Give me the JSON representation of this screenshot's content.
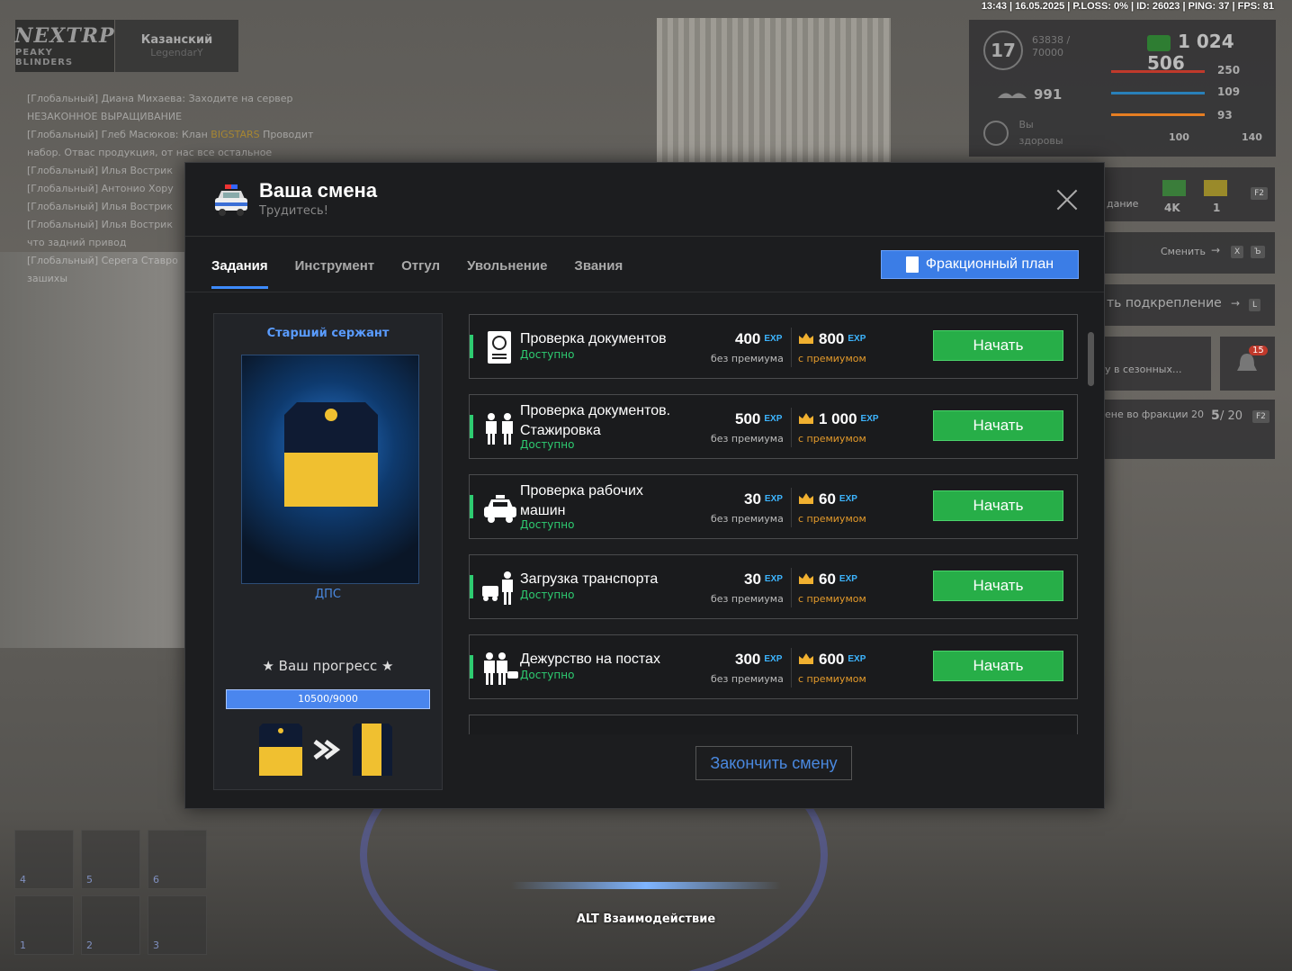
{
  "statusbar": {
    "text": "13:43 | 16.05.2025 | P.LOSS: 0% | ID: 26023 | PING: 37 | FPS: 81"
  },
  "logo": {
    "main": "NEXTRP",
    "sub": "PEAKY BLINDERS"
  },
  "server": {
    "name": "Казанский",
    "sub": "LegendarY"
  },
  "chat": {
    "lines": [
      "[Глобальный] Диана Михаева: Заходите на сервер",
      "НЕЗАКОННОЕ ВЫРАЩИВАНИЕ",
      "[Глобальный] Глеб Масюков: Клан",
      "набор. Отвас продукция, от нас все остальное",
      "[Глобальный] Илья Вострик",
      "[Глобальный] Антонио Хору",
      "[Глобальный] Илья Вострик",
      "[Глобальный] Илья Вострик",
      "что задний привод",
      "[Глобальный] Серега Ставро",
      "зашихы"
    ],
    "clan_tag": "BIGSTARS",
    "clan_suffix": "Проводит"
  },
  "hud": {
    "level": "17",
    "xp": "63838 /",
    "xp_max": "70000",
    "money": "1 024 506",
    "run": "991",
    "health_text": "Вы",
    "health_text2": "здоровы",
    "stats": [
      "250",
      "109",
      "93"
    ],
    "bottom_left": "100",
    "bottom_right": "140",
    "bar_colors": [
      "#c0392b",
      "#2980b9",
      "#e67e22"
    ]
  },
  "hud_cards": {
    "bonus_label": "дание",
    "bonus_a": "4K",
    "bonus_b": "1",
    "f2": "F2",
    "change_label": "Сменить",
    "change_key1": "X",
    "change_key2": "Ъ",
    "backup_label": "ть подкрепление",
    "backup_key": "L",
    "season_label": "у в сезонных...",
    "notif_count": "15",
    "faction_label": "ене во фракции 20",
    "faction_progress": "5",
    "faction_total": "/ 20",
    "faction_key": "F2"
  },
  "hotbar": {
    "slots": [
      "4",
      "5",
      "6",
      "1",
      "2",
      "3"
    ]
  },
  "alt_interact": "ALT Взаимодействие",
  "modal": {
    "title": "Ваша смена",
    "subtitle": "Трудитесь!",
    "tabs": [
      "Задания",
      "Инструмент",
      "Отгул",
      "Увольнение",
      "Звания"
    ],
    "plan_button": "Фракционный план",
    "end_shift": "Закончить смену"
  },
  "rank": {
    "name": "Старший сержант",
    "unit": "ДПС",
    "progress_label": "★ Ваш прогресс ★",
    "progress_text": "10500/9000",
    "progress_fraction": 1.0
  },
  "tasks": [
    {
      "name": "Проверка документов",
      "status": "Доступно",
      "basic": "400",
      "premium": "800",
      "button": "Начать",
      "icon": "passport-icon"
    },
    {
      "name": "Проверка документов.",
      "name2": "Стажировка",
      "status": "Доступно",
      "basic": "500",
      "premium": "1 000",
      "button": "Начать",
      "icon": "officers-icon"
    },
    {
      "name": "Проверка рабочих",
      "name2": "машин",
      "status": "Доступно",
      "basic": "30",
      "premium": "60",
      "button": "Начать",
      "icon": "police-car-icon"
    },
    {
      "name": "Загрузка транспорта",
      "status": "Доступно",
      "basic": "30",
      "premium": "60",
      "button": "Начать",
      "icon": "loading-icon"
    },
    {
      "name": "Дежурство на постах",
      "status": "Доступно",
      "basic": "300",
      "premium": "600",
      "button": "Начать",
      "icon": "guard-icon"
    }
  ],
  "labels": {
    "exp": "EXP",
    "no_premium": "без премиума",
    "with_premium": "с премиумом"
  },
  "colors": {
    "accent": "#3d8bfd",
    "start": "#27ae48",
    "available": "#2ecc71",
    "premium": "#e39a2b",
    "exp": "#3db5ff"
  }
}
